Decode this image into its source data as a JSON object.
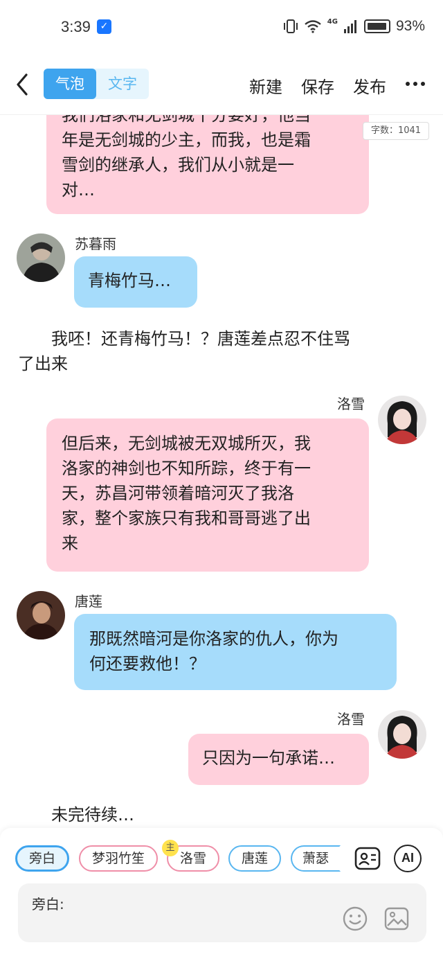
{
  "status_bar": {
    "time": "3:39",
    "network": "4G",
    "battery_pct": "93%"
  },
  "header": {
    "tabs": [
      {
        "label": "气泡",
        "active": true
      },
      {
        "label": "文字",
        "active": false
      }
    ],
    "new_label": "新建",
    "save_label": "保存",
    "publish_label": "发布",
    "word_count": "字数：1041"
  },
  "messages": {
    "m1": {
      "speaker": "洛雪",
      "side": "right",
      "lines": [
        "我们洛家和无剑城十分要好，他当",
        "年是无剑城的少主，而我，也是霜",
        "雪剑的继承人，我们从小就是一",
        "对…"
      ]
    },
    "m2": {
      "speaker": "苏暮雨",
      "side": "left",
      "text": "青梅竹马…"
    },
    "m3": {
      "type": "narration",
      "lines": [
        "　　我呸！还青梅竹马！？唐莲差点忍不住骂",
        "了出来"
      ]
    },
    "m4": {
      "speaker": "洛雪",
      "side": "right",
      "lines": [
        "但后来，无剑城被无双城所灭，我",
        "洛家的神剑也不知所踪，终于有一",
        "天，苏昌河带领着暗河灭了我洛",
        "家，整个家族只有我和哥哥逃了出",
        "来"
      ]
    },
    "m5": {
      "speaker": "唐莲",
      "side": "left",
      "lines": [
        "那既然暗河是你洛家的仇人，你为",
        "何还要救他！？"
      ]
    },
    "m6": {
      "speaker": "洛雪",
      "side": "right",
      "text": "只因为一句承诺…"
    },
    "m7": {
      "type": "narration",
      "text": "　　未完待续…"
    }
  },
  "role_bar": {
    "roles": [
      {
        "label": "旁白",
        "style": "narration",
        "selected": true
      },
      {
        "label": "梦羽竹笙",
        "style": "pink"
      },
      {
        "label": "洛雪",
        "style": "pink",
        "badge": "主"
      },
      {
        "label": "唐莲",
        "style": "blue"
      },
      {
        "label": "萧瑟",
        "style": "blue"
      }
    ],
    "ai_label": "AI"
  },
  "input": {
    "label": "旁白:"
  },
  "icons": {
    "back": "chevron-left-icon",
    "more": "more-dots-icon",
    "role_manage": "contact-card-icon",
    "emoji": "smiley-icon",
    "image": "image-icon",
    "tip": "lightbulb-icon"
  },
  "colors": {
    "accent_blue": "#3ea4ee",
    "pink_bubble": "#ffd0dc",
    "blue_bubble": "#a6dcfb"
  }
}
